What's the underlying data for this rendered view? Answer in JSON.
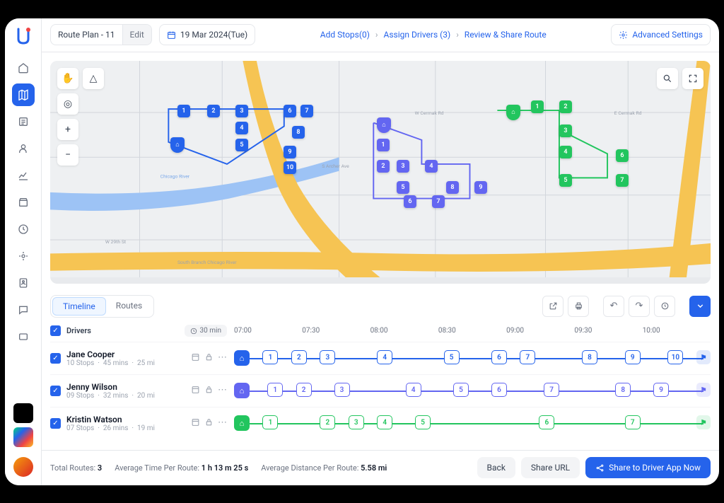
{
  "topbar": {
    "plan_name": "Route Plan - 11",
    "edit_label": "Edit",
    "date": "19 Mar 2024(Tue)",
    "breadcrumb": {
      "s1": "Add Stops(0)",
      "s2": "Assign Drivers (3)",
      "s3": "Review & Share Route"
    },
    "advanced": "Advanced Settings"
  },
  "map": {
    "routes": [
      {
        "color": "#2563eb",
        "stops": 10
      },
      {
        "color": "#6366f1",
        "stops": 9
      },
      {
        "color": "#22c55e",
        "stops": 7
      }
    ]
  },
  "panel": {
    "tabs": {
      "timeline": "Timeline",
      "routes": "Routes"
    },
    "header": {
      "drivers": "Drivers",
      "interval": "30 min"
    },
    "times": {
      "t1": "07:00",
      "t2": "07:30",
      "t3": "08:00",
      "t4": "08:30",
      "t5": "09:00",
      "t6": "09:30",
      "t7": "10:00"
    },
    "drivers": [
      {
        "name": "Jane Cooper",
        "stops": "10 Stops",
        "mins": "45 mins",
        "dist": "25 mi",
        "color": "#2563eb",
        "count": 10
      },
      {
        "name": "Jenny Wilson",
        "stops": "09 Stops",
        "mins": "32 mins",
        "dist": "20 mi",
        "color": "#6366f1",
        "count": 9
      },
      {
        "name": "Kristin Watson",
        "stops": "07 Stops",
        "mins": "26 mins",
        "dist": "19 mi",
        "color": "#22c55e",
        "count": 7
      }
    ]
  },
  "footer": {
    "total_label": "Total Routes:",
    "total_value": "3",
    "avg_time_label": "Average Time Per Route:",
    "avg_time_value": "1 h 13 m 25 s",
    "avg_dist_label": "Average Distance Per Route:",
    "avg_dist_value": "5.58 mi",
    "back": "Back",
    "share_url": "Share URL",
    "share_app": "Share to Driver App Now"
  }
}
